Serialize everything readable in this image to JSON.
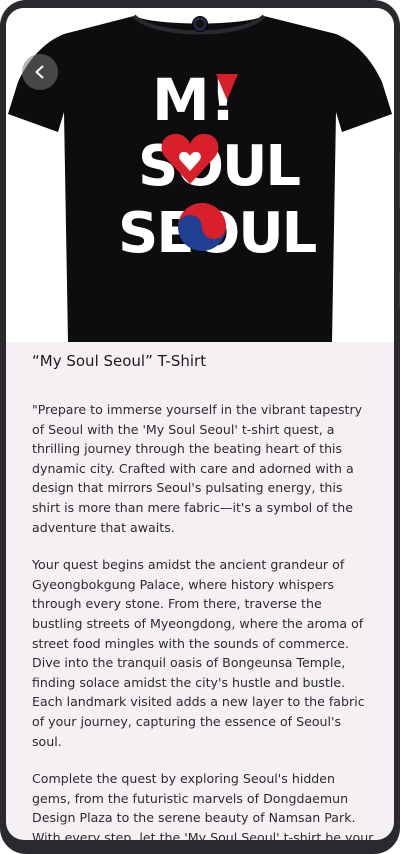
{
  "product": {
    "title": "“My Soul Seoul” T-Shirt",
    "shirt_graphic_text": [
      "M!",
      "SOUL",
      "SEOUL"
    ],
    "paragraphs": [
      "\"Prepare to immerse yourself in the vibrant tapestry of Seoul with the 'My Soul Seoul' t-shirt quest, a thrilling journey through the beating heart of this dynamic city. Crafted with care and adorned with a design that mirrors Seoul's pulsating energy, this shirt is more than mere fabric—it's a symbol of the adventure that awaits.",
      "Your quest begins amidst the ancient grandeur of Gyeongbokgung Palace, where history whispers through every stone. From there, traverse the bustling streets of Myeongdong, where the aroma of street food mingles with the sounds of commerce. Dive into the tranquil oasis of Bongeunsa Temple, finding solace amidst the city's hustle and bustle. Each landmark visited adds a new layer to the fabric of your journey, capturing the essence of Seoul's soul.",
      "Complete the quest by exploring Seoul's hidden gems, from the futuristic marvels of Dongdaemun Design Plaza to the serene beauty of Namsan Park. With every step, let the 'My Soul Seoul' t-shirt be your faithful companion, a tangible reminder of the soul-stirring"
    ]
  },
  "icons": {
    "back": "back-arrow-icon",
    "heart": "heart-icon",
    "taegeuk": "taegeuk-icon"
  },
  "colors": {
    "shirt": "#0d0d0f",
    "red": "#d81f2a",
    "blue": "#1f3f93",
    "white": "#ffffff",
    "background": "#f5f0f4"
  }
}
